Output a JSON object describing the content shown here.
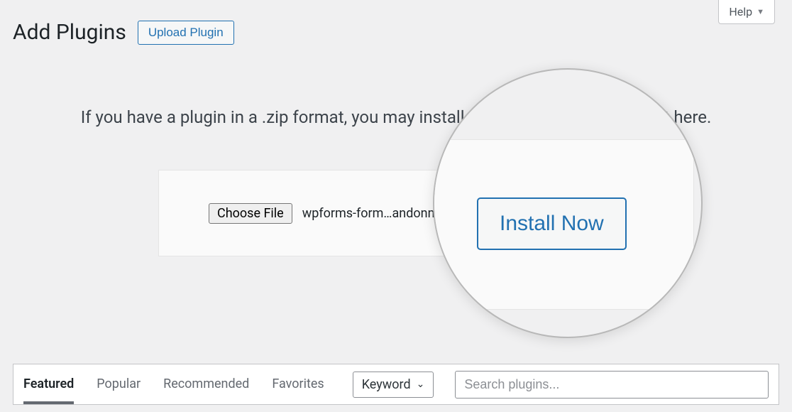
{
  "header": {
    "title": "Add Plugins",
    "upload_button": "Upload Plugin",
    "help_label": "Help"
  },
  "upload": {
    "instruction": "If you have a plugin in a .zip format, you may install or update it by uploading it here.",
    "choose_file_label": "Choose File",
    "selected_filename": "wpforms-form…andonment.zip",
    "install_label": "Install Now"
  },
  "zoom": {
    "install_label": "Install Now"
  },
  "filter": {
    "tabs": [
      {
        "label": "Featured",
        "active": true
      },
      {
        "label": "Popular",
        "active": false
      },
      {
        "label": "Recommended",
        "active": false
      },
      {
        "label": "Favorites",
        "active": false
      }
    ],
    "select_label": "Keyword",
    "search_placeholder": "Search plugins..."
  }
}
